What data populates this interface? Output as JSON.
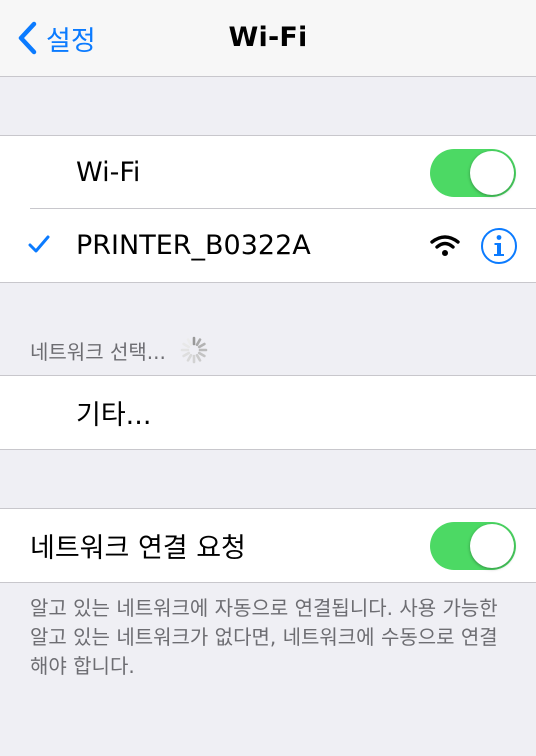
{
  "navbar": {
    "back_label": "설정",
    "title": "Wi-Fi"
  },
  "wifi_group": {
    "wifi_label": "Wi-Fi",
    "wifi_enabled": true,
    "connected_network": "PRINTER_B0322A"
  },
  "networks_section": {
    "header": "네트워크 선택...",
    "other_label": "기타..."
  },
  "ask_group": {
    "label": "네트워크 연결 요청",
    "enabled": true,
    "footer": "알고 있는 네트워크에 자동으로 연결됩니다. 사용 가능한 알고 있는 네트워크가 없다면, 네트워크에 수동으로 연결해야 합니다."
  },
  "colors": {
    "accent": "#0b7bff",
    "toggle_on": "#4cd964",
    "background": "#efeff4"
  }
}
